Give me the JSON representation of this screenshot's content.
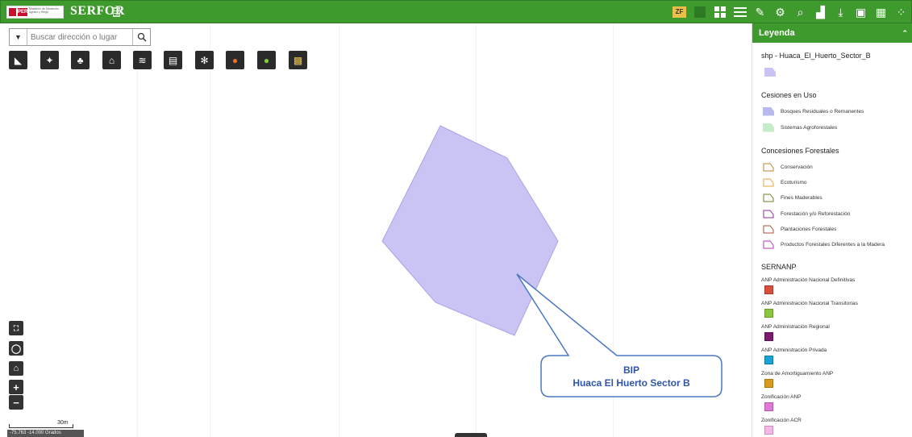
{
  "header": {
    "logo_gov": "PERÚ",
    "logo_ministry": "Ministerio de Desarrollo Agrario y Riego",
    "brand": "SERFOR",
    "zf_label": "ZF"
  },
  "search": {
    "placeholder": "Buscar dirección o lugar"
  },
  "callout": {
    "line1": "BIP",
    "line2": "Huaca El Huerto Sector B"
  },
  "map": {
    "scale_label": "30m",
    "coords": "-75.763 -14.000 Grados",
    "polygon_color": "#c9c4f3",
    "polygon_stroke": "#a9a3e6",
    "callout_color": "#4a78c4"
  },
  "legend": {
    "title": "Leyenda",
    "layer1_title": "shp - Huaca_El_Huerto_Sector_B",
    "group_cesiones": "Cesiones en Uso",
    "cesiones": [
      {
        "label": "Bosques Residuales o Remanentes",
        "color": "#b8b9ec"
      },
      {
        "label": "Sistemas Agroforestales",
        "color": "#c6ecc9"
      }
    ],
    "group_concesiones": "Concesiones Forestales",
    "concesiones": [
      {
        "label": "Conservación",
        "color": "#b8862e"
      },
      {
        "label": "Ecoturismo",
        "color": "#e5a73a"
      },
      {
        "label": "Fines Maderables",
        "color": "#6e7f2a"
      },
      {
        "label": "Forestación y/o Reforestación",
        "color": "#8a2fa0"
      },
      {
        "label": "Plantaciones Forestales",
        "color": "#a8523a"
      },
      {
        "label": "Productos Forestales Diferentes a la Madera",
        "color": "#b23ab8"
      }
    ],
    "group_sernanp": "SERNANP",
    "sernanp": [
      {
        "label": "ANP Administración Nacional Definitivas",
        "color": "#d94f3d"
      },
      {
        "label": "ANP Administración Nacional Transitorias",
        "color": "#8dc63f"
      },
      {
        "label": "ANP Administración Regional",
        "color": "#7b1a6e"
      },
      {
        "label": "ANP Administración Privada",
        "color": "#1aa3d6"
      },
      {
        "label": "Zona de Amortiguamiento ANP",
        "color": "#d99a1f"
      },
      {
        "label": "Zonificación ANP",
        "color": "#e07ad8"
      },
      {
        "label": "Zonificación ACR",
        "color": "#f3b8e6"
      }
    ]
  }
}
